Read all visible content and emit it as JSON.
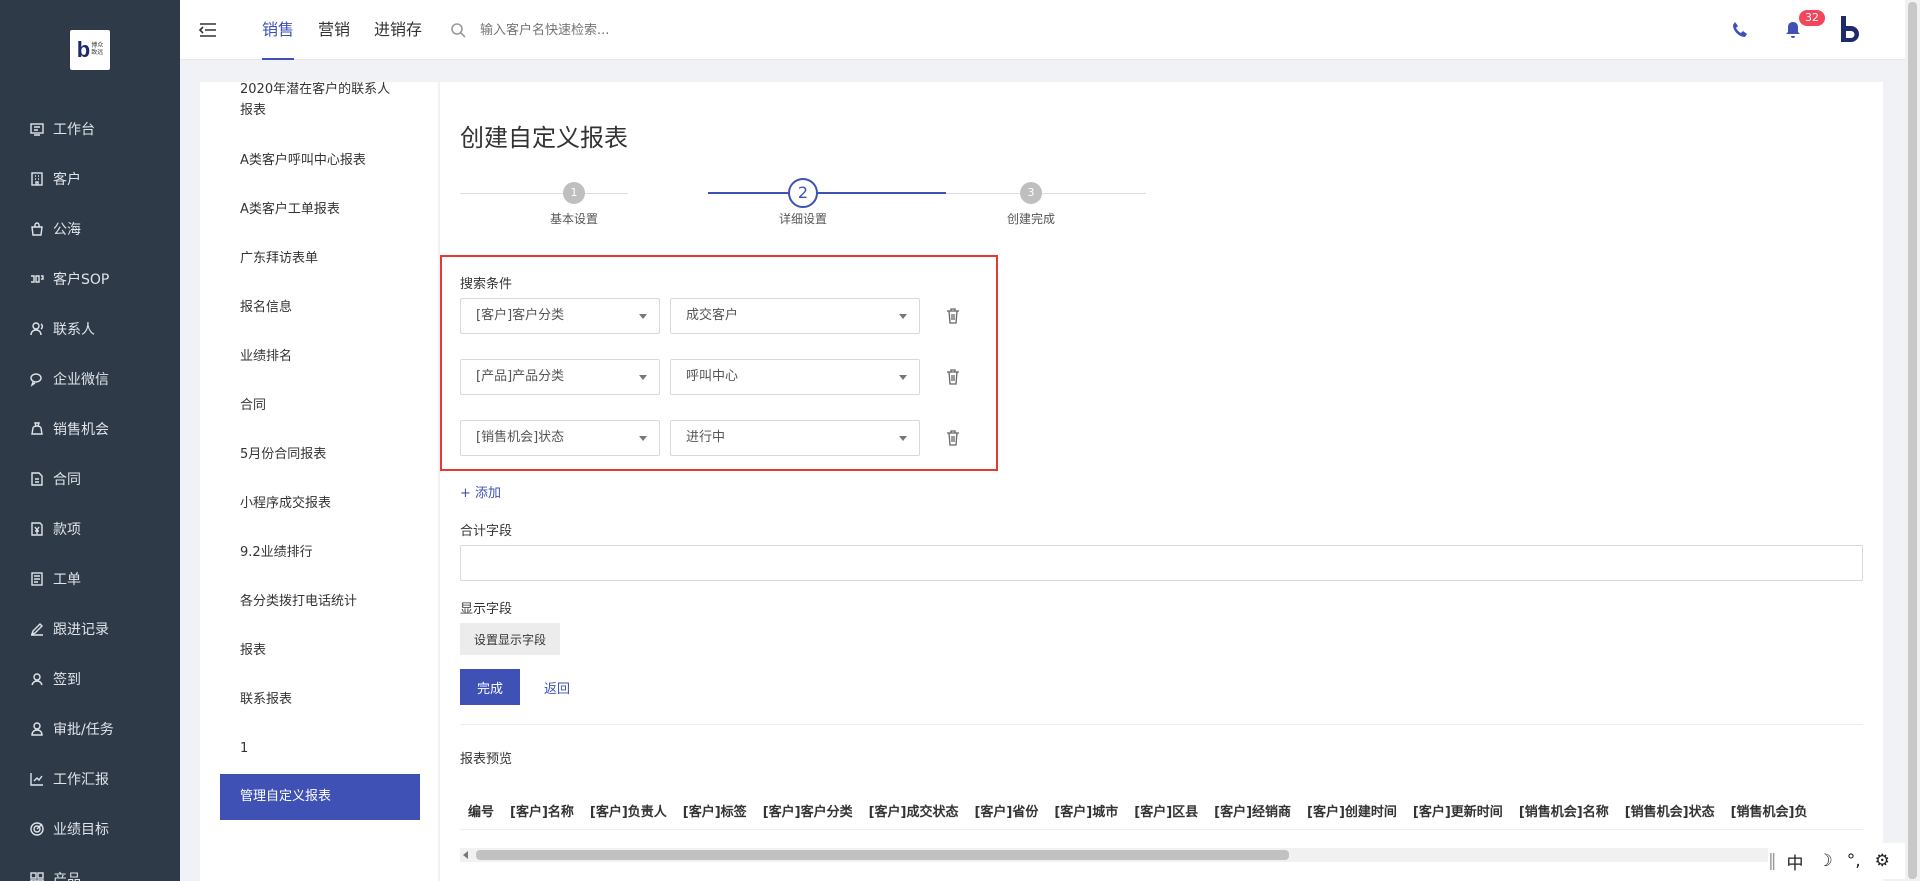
{
  "logo": {
    "main": "b",
    "small_line1": "博众",
    "small_line2": "致远"
  },
  "nav": {
    "items": [
      {
        "label": "工作台",
        "icon": "monitor-icon"
      },
      {
        "label": "客户",
        "icon": "building-icon"
      },
      {
        "label": "公海",
        "icon": "bag-icon"
      },
      {
        "label": "客户SOP",
        "icon": "sop-icon"
      },
      {
        "label": "联系人",
        "icon": "contacts-icon"
      },
      {
        "label": "企业微信",
        "icon": "wechat-icon"
      },
      {
        "label": "销售机会",
        "icon": "moneybag-icon"
      },
      {
        "label": "合同",
        "icon": "contract-icon"
      },
      {
        "label": "款项",
        "icon": "payment-icon"
      },
      {
        "label": "工单",
        "icon": "ticket-icon"
      },
      {
        "label": "跟进记录",
        "icon": "edit-icon"
      },
      {
        "label": "签到",
        "icon": "location-icon"
      },
      {
        "label": "审批/任务",
        "icon": "approval-icon"
      },
      {
        "label": "工作汇报",
        "icon": "report-icon"
      },
      {
        "label": "业绩目标",
        "icon": "target-icon"
      },
      {
        "label": "产品",
        "icon": "grid-icon"
      }
    ]
  },
  "header": {
    "tabs": [
      {
        "label": "销售",
        "active": true
      },
      {
        "label": "营销",
        "active": false
      },
      {
        "label": "进销存",
        "active": false
      }
    ],
    "search_placeholder": "输入客户名快速检索...",
    "notification_count": "32"
  },
  "reports": {
    "items": [
      "2020年潜在客户的联系人",
      "报表",
      "A类客户呼叫中心报表",
      "A类客户工单报表",
      "广东拜访表单",
      "报名信息",
      "业绩排名",
      "合同",
      "5月份合同报表",
      "小程序成交报表",
      "9.2业绩排行",
      "各分类拨打电话统计",
      "报表",
      "联系报表",
      "1"
    ],
    "active_item": "管理自定义报表"
  },
  "page": {
    "title": "创建自定义报表",
    "steps": [
      {
        "num": "1",
        "label": "基本设置"
      },
      {
        "num": "2",
        "label": "详细设置"
      },
      {
        "num": "3",
        "label": "创建完成"
      }
    ],
    "current_step": 2,
    "conditions_label": "搜索条件",
    "conditions": [
      {
        "field": "[客户]客户分类",
        "value": "成交客户"
      },
      {
        "field": "[产品]产品分类",
        "value": "呼叫中心"
      },
      {
        "field": "[销售机会]状态",
        "value": "进行中"
      }
    ],
    "add_label": "+ 添加",
    "total_fields_label": "合计字段",
    "display_fields_label": "显示字段",
    "set_display_button": "设置显示字段",
    "finish_button": "完成",
    "back_link": "返回",
    "preview_label": "报表预览",
    "preview_columns": [
      "编号",
      "[客户]名称",
      "[客户]负责人",
      "[客户]标签",
      "[客户]客户分类",
      "[客户]成交状态",
      "[客户]省份",
      "[客户]城市",
      "[客户]区县",
      "[客户]经销商",
      "[客户]创建时间",
      "[客户]更新时间",
      "[销售机会]名称",
      "[销售机会]状态",
      "[销售机会]负"
    ]
  },
  "ime": {
    "lang": "中",
    "moon": "☽",
    "punct": "°,",
    "gear": "⚙"
  },
  "colors": {
    "primary": "#3f51b5",
    "sidebar": "#2f3a48",
    "highlight_border": "#e53935",
    "badge": "#f5455b"
  }
}
